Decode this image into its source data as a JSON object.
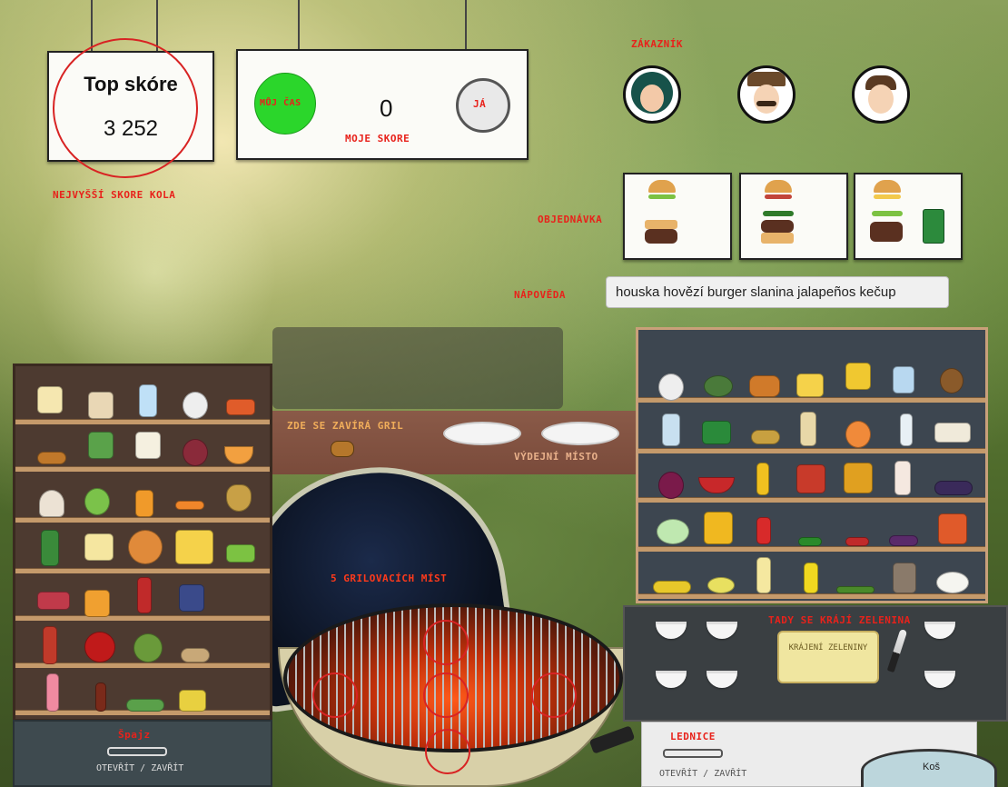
{
  "top_score": {
    "title": "Top skóre",
    "value": "3 252",
    "label": "Nejvyšší skore kola"
  },
  "status": {
    "timer_label": "Můj čas",
    "timer_fraction": 1.0,
    "score_value": "0",
    "score_label": "Moje skore",
    "player_label": "JÁ"
  },
  "labels": {
    "customer": "Zákazník",
    "order": "Objednávka",
    "hint": "Nápověda",
    "grill_close": "Zde se zavírá gril",
    "serving": "Výdejní místo",
    "grill_spots": "5 grilovacích míst",
    "cutting_area": "Tady se krájí zelenina",
    "cutting_board": "Krájení zeleniny"
  },
  "customers": [
    {
      "name": "customer-woman",
      "order": [
        "bun-top",
        "lettuce",
        "bun-bottom",
        "patty"
      ]
    },
    {
      "name": "customer-man-hat",
      "order": [
        "bun-top",
        "bacon",
        "jalapenos",
        "patty",
        "bun-bottom"
      ]
    },
    {
      "name": "customer-boy",
      "order": [
        "bun-top",
        "cheese",
        "lettuce",
        "patty",
        "can-drink"
      ]
    }
  ],
  "hint_text": "houska hovězí burger slanina jalapeños kečup",
  "pantry": {
    "title": "Špajz",
    "toggle": "Otevřít / Zavřít"
  },
  "fridge": {
    "title": "Lednice",
    "toggle": "Otevřít / Zavřít"
  },
  "trash": {
    "label": "Koš"
  },
  "colors": {
    "accent": "#e8221b",
    "timer": "#2bd62b",
    "shelf": "#4d3a30"
  }
}
